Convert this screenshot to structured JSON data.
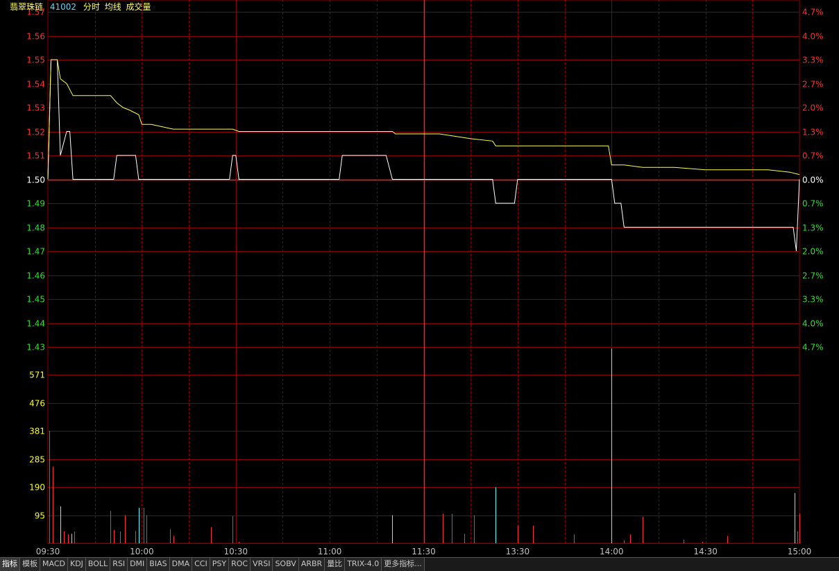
{
  "header": {
    "stock_name": "翡翠珠链",
    "stock_code": "41002",
    "label_timeshare": "分时",
    "label_avgline": "均线",
    "label_volume": "成交量"
  },
  "colors": {
    "background": "#000000",
    "grid": "#8b0000",
    "axis_red": "#ff3030",
    "axis_green": "#33dd33",
    "axis_yellow": "#ffff00",
    "price_line": "#ffffff",
    "avg_line": "#ffff44",
    "vol_up": "#ff3030",
    "vol_down": "#55ffff",
    "time_label": "#c0c0c0"
  },
  "chart_data": [
    {
      "type": "line",
      "title": "",
      "prev_close": 1.5,
      "y_ticks_price": [
        "1.57",
        "1.56",
        "1.55",
        "1.54",
        "1.53",
        "1.52",
        "1.51",
        "1.50",
        "1.49",
        "1.48",
        "1.47",
        "1.46",
        "1.45",
        "1.44",
        "1.43"
      ],
      "y_ticks_pct": [
        "4.7%",
        "4.0%",
        "3.3%",
        "2.7%",
        "2.0%",
        "1.3%",
        "0.7%",
        "0.0%",
        "0.7%",
        "1.3%",
        "2.0%",
        "2.7%",
        "3.3%",
        "4.0%",
        "4.7%"
      ],
      "ylim": [
        1.43,
        1.57
      ],
      "x_ticks": [
        "09:30",
        "10:00",
        "10:30",
        "11:00",
        "11:30",
        "13:30",
        "14:00",
        "14:30",
        "15:00"
      ],
      "x_minutes": [
        0,
        30,
        60,
        90,
        120,
        150,
        180,
        210,
        240
      ],
      "series": [
        {
          "name": "分时",
          "points": [
            [
              0,
              1.5
            ],
            [
              1,
              1.55
            ],
            [
              3,
              1.55
            ],
            [
              4,
              1.51
            ],
            [
              6,
              1.52
            ],
            [
              7,
              1.52
            ],
            [
              8,
              1.5
            ],
            [
              21,
              1.5
            ],
            [
              22,
              1.51
            ],
            [
              28,
              1.51
            ],
            [
              29,
              1.5
            ],
            [
              58,
              1.5
            ],
            [
              59,
              1.51
            ],
            [
              60,
              1.51
            ],
            [
              61,
              1.5
            ],
            [
              93,
              1.5
            ],
            [
              94,
              1.51
            ],
            [
              108,
              1.51
            ],
            [
              110,
              1.5
            ],
            [
              142,
              1.5
            ],
            [
              143,
              1.49
            ],
            [
              149,
              1.49
            ],
            [
              150,
              1.5
            ],
            [
              180,
              1.5
            ],
            [
              181,
              1.49
            ],
            [
              183,
              1.49
            ],
            [
              184,
              1.48
            ],
            [
              238,
              1.48
            ],
            [
              239,
              1.47
            ],
            [
              240,
              1.5
            ]
          ]
        },
        {
          "name": "均线",
          "points": [
            [
              0,
              1.5
            ],
            [
              1,
              1.55
            ],
            [
              3,
              1.55
            ],
            [
              4,
              1.542
            ],
            [
              6,
              1.54
            ],
            [
              8,
              1.535
            ],
            [
              20,
              1.535
            ],
            [
              22,
              1.532
            ],
            [
              24,
              1.53
            ],
            [
              26,
              1.529
            ],
            [
              29,
              1.527
            ],
            [
              30,
              1.523
            ],
            [
              33,
              1.523
            ],
            [
              40,
              1.521
            ],
            [
              59,
              1.521
            ],
            [
              61,
              1.52
            ],
            [
              110,
              1.52
            ],
            [
              111,
              1.519
            ],
            [
              125,
              1.519
            ],
            [
              130,
              1.518
            ],
            [
              135,
              1.517
            ],
            [
              142,
              1.516
            ],
            [
              143,
              1.514
            ],
            [
              160,
              1.514
            ],
            [
              179,
              1.514
            ],
            [
              180,
              1.506
            ],
            [
              184,
              1.506
            ],
            [
              190,
              1.505
            ],
            [
              200,
              1.505
            ],
            [
              210,
              1.504
            ],
            [
              230,
              1.504
            ],
            [
              237,
              1.503
            ],
            [
              240,
              1.502
            ]
          ]
        }
      ]
    },
    {
      "type": "bar",
      "title": "成交量",
      "y_ticks": [
        "571",
        "476",
        "381",
        "285",
        "190",
        "95"
      ],
      "ylim": [
        0,
        666
      ],
      "bars": [
        {
          "t": 0.5,
          "v": 381,
          "dir": "up"
        },
        {
          "t": 1.5,
          "v": 260,
          "dir": "up"
        },
        {
          "t": 4,
          "v": 125,
          "dir": "down"
        },
        {
          "t": 5,
          "v": 40,
          "dir": "up"
        },
        {
          "t": 6.5,
          "v": 30,
          "dir": "up"
        },
        {
          "t": 7.5,
          "v": 32,
          "dir": "down"
        },
        {
          "t": 8.5,
          "v": 40,
          "dir": "up"
        },
        {
          "t": 20,
          "v": 110,
          "dir": "up"
        },
        {
          "t": 21,
          "v": 45,
          "dir": "up"
        },
        {
          "t": 23,
          "v": 40,
          "dir": "up"
        },
        {
          "t": 24.5,
          "v": 95,
          "dir": "up"
        },
        {
          "t": 28,
          "v": 42,
          "dir": "up"
        },
        {
          "t": 29,
          "v": 120,
          "dir": "down"
        },
        {
          "t": 30.5,
          "v": 120,
          "dir": "up"
        },
        {
          "t": 31.5,
          "v": 95,
          "dir": "up"
        },
        {
          "t": 39,
          "v": 48,
          "dir": "up"
        },
        {
          "t": 40,
          "v": 25,
          "dir": "up"
        },
        {
          "t": 52,
          "v": 55,
          "dir": "up"
        },
        {
          "t": 59,
          "v": 92,
          "dir": "up"
        },
        {
          "t": 61,
          "v": 5,
          "dir": "up"
        },
        {
          "t": 110,
          "v": 95,
          "dir": "down"
        },
        {
          "t": 126,
          "v": 100,
          "dir": "up"
        },
        {
          "t": 129,
          "v": 100,
          "dir": "up"
        },
        {
          "t": 133,
          "v": 32,
          "dir": "up"
        },
        {
          "t": 136,
          "v": 95,
          "dir": "up"
        },
        {
          "t": 143,
          "v": 190,
          "dir": "down"
        },
        {
          "t": 150,
          "v": 60,
          "dir": "up"
        },
        {
          "t": 155,
          "v": 60,
          "dir": "up"
        },
        {
          "t": 168,
          "v": 30,
          "dir": "up"
        },
        {
          "t": 180,
          "v": 660,
          "dir": "down"
        },
        {
          "t": 184,
          "v": 10,
          "dir": "up"
        },
        {
          "t": 186,
          "v": 30,
          "dir": "up"
        },
        {
          "t": 190,
          "v": 90,
          "dir": "up"
        },
        {
          "t": 203,
          "v": 12,
          "dir": "up"
        },
        {
          "t": 209,
          "v": 5,
          "dir": "up"
        },
        {
          "t": 217,
          "v": 25,
          "dir": "up"
        },
        {
          "t": 238.5,
          "v": 170,
          "dir": "down"
        },
        {
          "t": 239.3,
          "v": 40,
          "dir": "up"
        },
        {
          "t": 240,
          "v": 100,
          "dir": "up"
        }
      ]
    }
  ],
  "indicator_tabs": [
    "指标",
    "模板",
    "MACD",
    "KDJ",
    "BOLL",
    "RSI",
    "DMI",
    "BIAS",
    "DMA",
    "CCI",
    "PSY",
    "ROC",
    "VRSI",
    "SOBV",
    "ARBR",
    "量比",
    "TRIX-4.0",
    "更多指标..."
  ],
  "active_tab_index": 0
}
